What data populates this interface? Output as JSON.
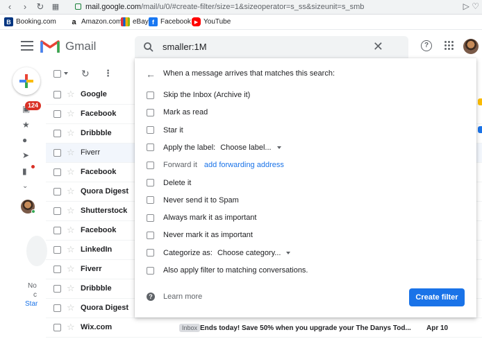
{
  "browser": {
    "url_host": "mail.google.com",
    "url_path": "/mail/u/0/#create-filter/size=1&sizeoperator=s_ss&sizeunit=s_smb",
    "bookmarks": [
      {
        "label": "Booking.com",
        "icon": "booking-icon",
        "color": "#003580",
        "glyph": "B"
      },
      {
        "label": "Amazon.com",
        "icon": "amazon-icon",
        "color": "#ffffff",
        "glyph": "a"
      },
      {
        "label": "eBay",
        "icon": "ebay-icon",
        "color": "#f5af02",
        "glyph": ""
      },
      {
        "label": "Facebook",
        "icon": "facebook-icon",
        "color": "#1877f2",
        "glyph": "f"
      },
      {
        "label": "YouTube",
        "icon": "youtube-icon",
        "color": "#ff0000",
        "glyph": "▶"
      }
    ]
  },
  "header": {
    "app_name": "Gmail",
    "search_value": "smaller:1M",
    "help_glyph": "?"
  },
  "rail": {
    "unread_count": "124",
    "notes": [
      "No",
      "c",
      "Star"
    ]
  },
  "list": {
    "rows": [
      {
        "sender": "Google",
        "highlight": false
      },
      {
        "sender": "Facebook",
        "highlight": false
      },
      {
        "sender": "Dribbble",
        "highlight": false
      },
      {
        "sender": "Fiverr",
        "highlight": true
      },
      {
        "sender": "Facebook",
        "highlight": false
      },
      {
        "sender": "Quora Digest",
        "highlight": false
      },
      {
        "sender": "Shutterstock",
        "highlight": false
      },
      {
        "sender": "Facebook",
        "highlight": false
      },
      {
        "sender": "LinkedIn",
        "highlight": false
      },
      {
        "sender": "Fiverr",
        "highlight": false
      },
      {
        "sender": "Dribbble",
        "highlight": false
      },
      {
        "sender": "Quora Digest",
        "highlight": false
      },
      {
        "sender": "Wix.com",
        "highlight": false
      }
    ],
    "last_row": {
      "label": "Inbox",
      "subject": "Ends today! Save 50% when you upgrade your The Danys Tod...",
      "date": "Apr 10"
    }
  },
  "filter": {
    "heading": "When a message arrives that matches this search:",
    "options": [
      {
        "label": "Skip the Inbox (Archive it)"
      },
      {
        "label": "Mark as read"
      },
      {
        "label": "Star it"
      },
      {
        "label": "Apply the label:",
        "dropdown": "Choose label..."
      },
      {
        "label": "Forward it",
        "link": "add forwarding address",
        "dim": true
      },
      {
        "label": "Delete it"
      },
      {
        "label": "Never send it to Spam"
      },
      {
        "label": "Always mark it as important"
      },
      {
        "label": "Never mark it as important"
      },
      {
        "label": "Categorize as:",
        "dropdown": "Choose category..."
      },
      {
        "label": "Also apply filter to matching conversations."
      }
    ],
    "learn_more": "Learn more",
    "create_button": "Create filter"
  }
}
